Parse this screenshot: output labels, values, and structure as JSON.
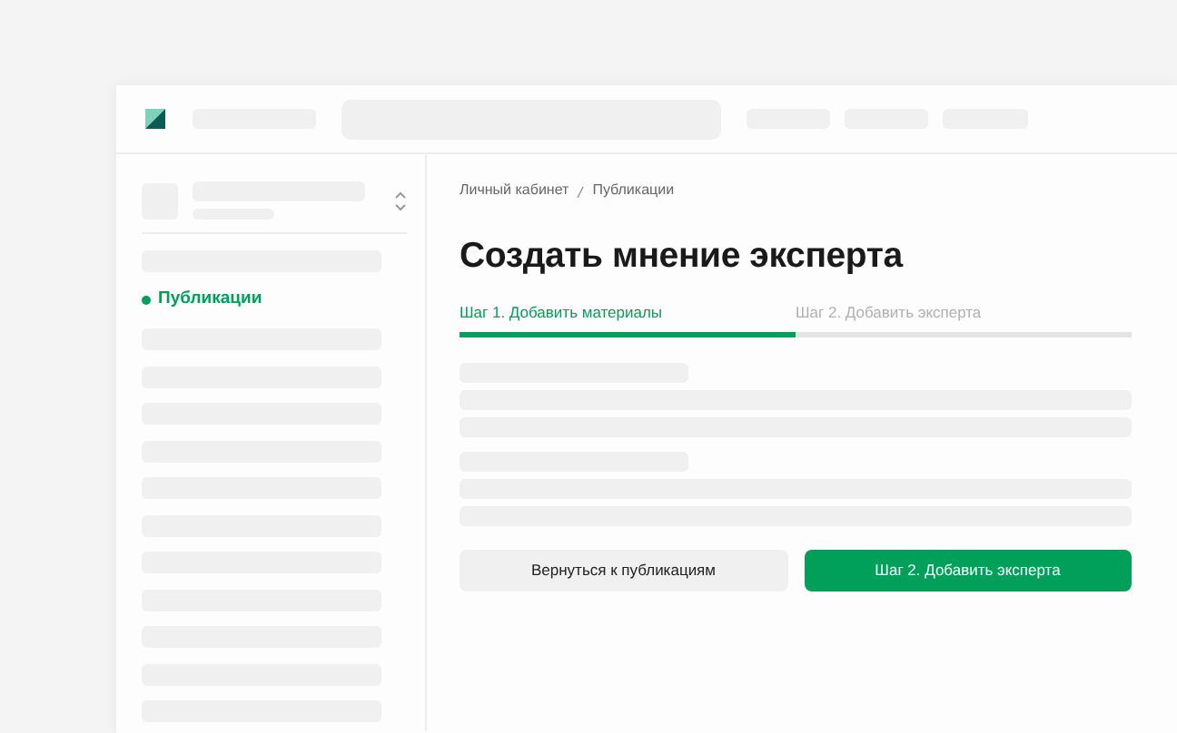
{
  "sidebar": {
    "items": [
      {
        "label": "Публикации",
        "selected": true
      }
    ]
  },
  "breadcrumb": [
    "Личный кабинет",
    "Публикации"
  ],
  "title": "Создать мнение эксперта",
  "steps": [
    {
      "label": "Шаг 1. Добавить материалы",
      "selected": true
    },
    {
      "label": "Шаг 2. Добавить эксперта",
      "selected": false
    }
  ],
  "buttons": [
    {
      "label": "Вернуться к публикациям",
      "kind": "secondary"
    },
    {
      "label": "Шаг 2. Добавить эксперта",
      "kind": "primary"
    }
  ]
}
